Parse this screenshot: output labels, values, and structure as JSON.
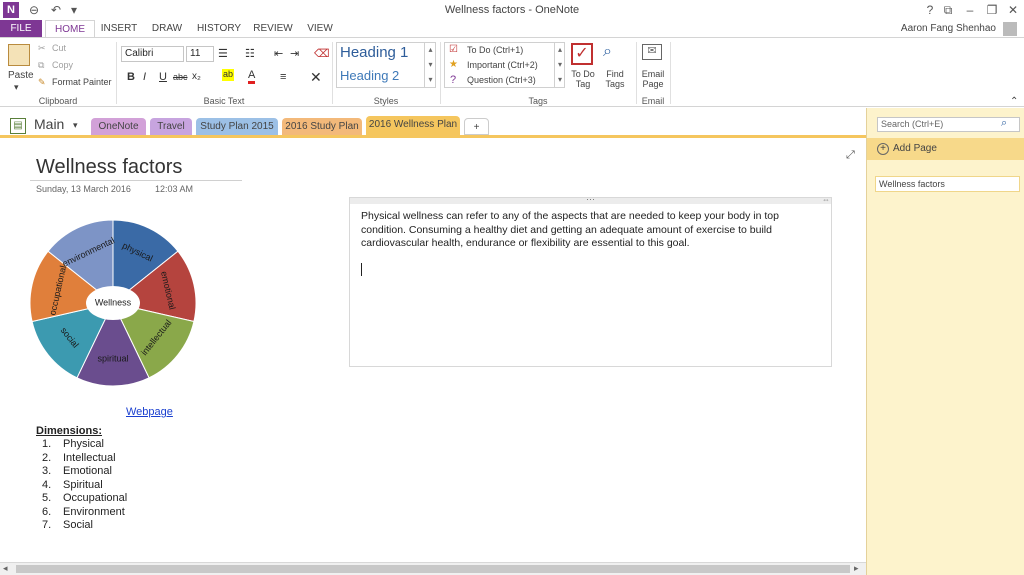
{
  "window": {
    "title": "Wellness factors - OneNote",
    "user": "Aaron Fang Shenhao",
    "controls": [
      "?",
      "⧉",
      "–",
      "❐",
      "✕"
    ]
  },
  "ribbon_tabs": [
    "FILE",
    "HOME",
    "INSERT",
    "DRAW",
    "HISTORY",
    "REVIEW",
    "VIEW"
  ],
  "clipboard": {
    "paste": "Paste",
    "cut": "Cut",
    "copy": "Copy",
    "format_painter": "Format Painter",
    "label": "Clipboard"
  },
  "basic_text": {
    "font": "Calibri",
    "size": "11",
    "label": "Basic Text",
    "bold": "B",
    "italic": "I",
    "underline": "U",
    "strike": "abc",
    "subscript": "x₂"
  },
  "styles": {
    "heading1": "Heading 1",
    "heading2": "Heading 2",
    "label": "Styles"
  },
  "tags": {
    "todo": "To Do (Ctrl+1)",
    "important": "Important (Ctrl+2)",
    "question": "Question (Ctrl+3)",
    "todo_tag_l1": "To Do",
    "todo_tag_l2": "Tag",
    "find_tags_l1": "Find",
    "find_tags_l2": "Tags",
    "label": "Tags"
  },
  "email": {
    "l1": "Email",
    "l2": "Page",
    "label": "Email"
  },
  "notebook": {
    "name": "Main",
    "sections": [
      {
        "label": "OneNote",
        "color": "#d2a1d8"
      },
      {
        "label": "Travel",
        "color": "#c7a4df"
      },
      {
        "label": "Study Plan 2015",
        "color": "#9cc0e6"
      },
      {
        "label": "2016 Study Plan",
        "color": "#f3b97a"
      },
      {
        "label": "2016 Wellness Plan",
        "color": "#f5c65e"
      },
      {
        "label": "+",
        "color": "#ffffff"
      }
    ]
  },
  "page": {
    "title": "Wellness factors",
    "date": "Sunday, 13 March 2016",
    "time": "12:03 AM",
    "note_text": "Physical wellness can refer to any of the aspects that are needed to keep your body in top condition. Consuming a healthy diet and getting an adequate amount of exercise to build cardiovascular health, endurance or flexibility are essential to this goal.",
    "link": "Webpage",
    "dimensions_title": "Dimensions:",
    "dimensions": [
      {
        "n": "1.",
        "label": "Physical"
      },
      {
        "n": "2.",
        "label": "Intellectual"
      },
      {
        "n": "3.",
        "label": "Emotional"
      },
      {
        "n": "4.",
        "label": "Spiritual"
      },
      {
        "n": "5.",
        "label": "Occupational"
      },
      {
        "n": "6.",
        "label": "Environment"
      },
      {
        "n": "7.",
        "label": "Social"
      }
    ]
  },
  "wheel": {
    "center": "Wellness",
    "segments": [
      {
        "label": "physical",
        "color": "#3a6aa6"
      },
      {
        "label": "emotional",
        "color": "#b5443e"
      },
      {
        "label": "intellectual",
        "color": "#8aa84a"
      },
      {
        "label": "spiritual",
        "color": "#6a4d8e"
      },
      {
        "label": "social",
        "color": "#3c9ab0"
      },
      {
        "label": "occupational",
        "color": "#e07f3b"
      },
      {
        "label": "environmental",
        "color": "#7d94c6"
      }
    ]
  },
  "right_pane": {
    "search_placeholder": "Search (Ctrl+E)",
    "add_page": "Add Page",
    "pages": [
      "Wellness factors"
    ]
  }
}
